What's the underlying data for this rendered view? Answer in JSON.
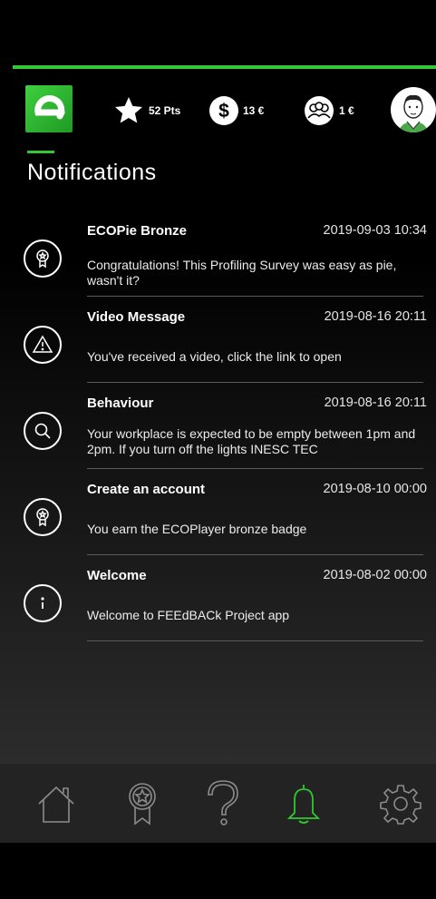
{
  "header": {
    "points": "52 Pts",
    "money": "13 €",
    "group": "1 €"
  },
  "page": {
    "title": "Notifications"
  },
  "notifications": [
    {
      "icon": "award-icon",
      "title": "ECOPie Bronze",
      "date": "2019-09-03 10:34",
      "body": "Congratulations! This Profiling Survey was easy as pie, wasn't it?"
    },
    {
      "icon": "warning-icon",
      "title": "Video Message",
      "date": "2019-08-16 20:11",
      "body": "You've received a video, click the link to open"
    },
    {
      "icon": "search-icon",
      "title": "Behaviour",
      "date": "2019-08-16 20:11",
      "body": "Your workplace is expected to be empty between 1pm and 2pm. If you turn off the lights INESC TEC"
    },
    {
      "icon": "award-icon",
      "title": "Create an account",
      "date": "2019-08-10 00:00",
      "body": "You earn the ECOPlayer bronze badge"
    },
    {
      "icon": "info-icon",
      "title": "Welcome",
      "date": "2019-08-02 00:00",
      "body": "Welcome to FEEdBACk Project app"
    }
  ],
  "nav": {
    "active": "notifications",
    "accent": "#32c832",
    "items": [
      "home",
      "achievements",
      "help",
      "notifications",
      "settings"
    ]
  }
}
